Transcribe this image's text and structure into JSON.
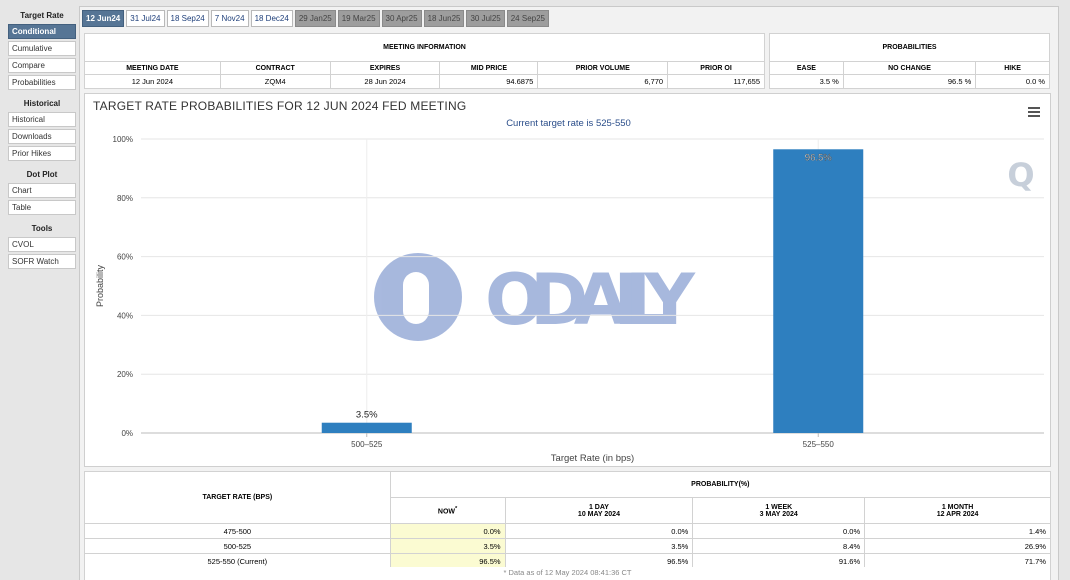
{
  "sidebar": {
    "groups": [
      {
        "heading": "Target Rate",
        "items": [
          "Conditional",
          "Cumulative",
          "Compare",
          "Probabilities"
        ]
      },
      {
        "heading": "Historical",
        "items": [
          "Historical",
          "Downloads",
          "Prior Hikes"
        ]
      },
      {
        "heading": "Dot Plot",
        "items": [
          "Chart",
          "Table"
        ]
      },
      {
        "heading": "Tools",
        "items": [
          "CVOL",
          "SOFR Watch"
        ]
      }
    ]
  },
  "tabs": [
    "12 Jun24",
    "31 Jul24",
    "18 Sep24",
    "7 Nov24",
    "18 Dec24",
    "29 Jan25",
    "19 Mar25",
    "30 Apr25",
    "18 Jun25",
    "30 Jul25",
    "24 Sep25"
  ],
  "meeting_info": {
    "title": "MEETING INFORMATION",
    "headers": [
      "MEETING DATE",
      "CONTRACT",
      "EXPIRES",
      "MID PRICE",
      "PRIOR VOLUME",
      "PRIOR OI"
    ],
    "values": [
      "12 Jun 2024",
      "ZQM4",
      "28 Jun 2024",
      "94.6875",
      "6,770",
      "117,655"
    ]
  },
  "probabilities": {
    "title": "PROBABILITIES",
    "headers": [
      "EASE",
      "NO CHANGE",
      "HIKE"
    ],
    "values": [
      "3.5 %",
      "96.5 %",
      "0.0 %"
    ]
  },
  "chart_data": {
    "type": "bar",
    "title": "TARGET RATE PROBABILITIES FOR 12 JUN 2024 FED MEETING",
    "subtitle": "Current target rate is 525-550",
    "categories": [
      "500–525",
      "525–550"
    ],
    "values": [
      3.5,
      96.5
    ],
    "data_labels": [
      "3.5%",
      "96.5%"
    ],
    "xlabel": "Target Rate (in bps)",
    "ylabel": "Probability",
    "ylim": [
      0,
      100
    ],
    "yticks": [
      0,
      20,
      40,
      60,
      80,
      100
    ],
    "ytick_labels": [
      "0%",
      "20%",
      "40%",
      "60%",
      "80%",
      "100%"
    ],
    "bar_color": "#2e7fbf",
    "grid": true
  },
  "watermark": {
    "text": "ODAILY"
  },
  "bottom_table": {
    "row_header": "TARGET RATE (BPS)",
    "group_header": "PROBABILITY(%)",
    "columns": [
      {
        "label": "NOW",
        "sub": "",
        "mark": "*"
      },
      {
        "label": "1 DAY",
        "sub": "10 MAY 2024"
      },
      {
        "label": "1 WEEK",
        "sub": "3 MAY 2024"
      },
      {
        "label": "1 MONTH",
        "sub": "12 APR 2024"
      }
    ],
    "rows": [
      {
        "rate": "475-500",
        "values": [
          "0.0%",
          "0.0%",
          "0.0%",
          "1.4%"
        ]
      },
      {
        "rate": "500-525",
        "values": [
          "3.5%",
          "3.5%",
          "8.4%",
          "26.9%"
        ]
      },
      {
        "rate": "525-550 (Current)",
        "values": [
          "96.5%",
          "96.5%",
          "91.6%",
          "71.7%"
        ]
      }
    ],
    "footnote": "* Data as of 12 May 2024 08:41:36 CT"
  }
}
